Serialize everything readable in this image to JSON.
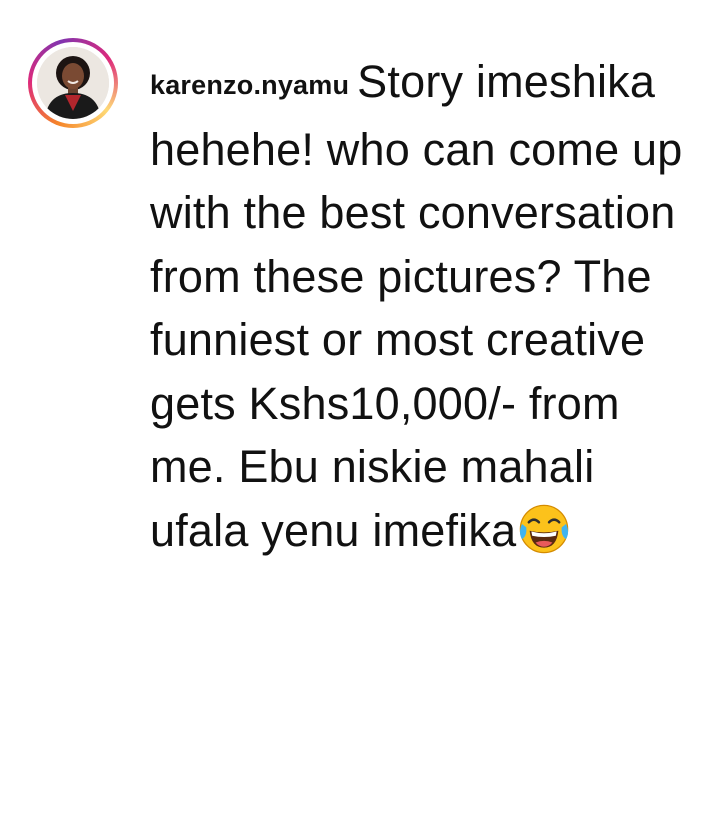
{
  "comment": {
    "username": "karenzo.nyamu",
    "text": "Story imeshika hehehe! who can come up with the best conversation from these pictures? The funniest or most creative gets Kshs10,000/- from me. Ebu niskie mahali ufala yenu imefika",
    "emoji": "face-with-tears-of-joy"
  },
  "avatar": {
    "icon": "profile-photo",
    "story_ring_colors": [
      "#f58529",
      "#dd2a7b",
      "#8134af",
      "#feda77"
    ]
  }
}
